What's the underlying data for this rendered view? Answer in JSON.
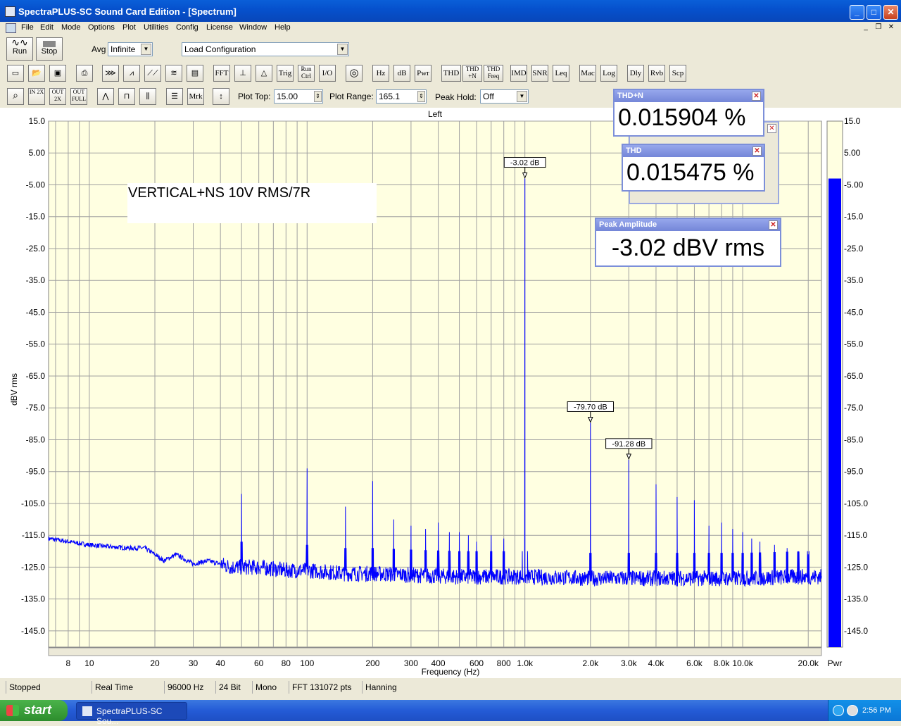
{
  "window": {
    "title": "SpectraPLUS-SC Sound Card Edition - [Spectrum]",
    "minimize": "_",
    "maximize": "□",
    "close": "✕"
  },
  "menu": [
    "File",
    "Edit",
    "Mode",
    "Options",
    "Plot",
    "Utilities",
    "Config",
    "License",
    "Window",
    "Help"
  ],
  "toolbar1": {
    "run": "Run",
    "stop": "Stop",
    "avg_label": "Avg",
    "avg_value": "Infinite",
    "load_config": "Load Configuration"
  },
  "toolbar2": [
    "FFT",
    "Trig",
    "Run Ctrl",
    "I/O",
    "Hz",
    "dB",
    "Pwr",
    "THD",
    "THD +N",
    "THD Freq",
    "IMD",
    "SNR",
    "Leq",
    "Mac",
    "Log",
    "Dly",
    "Rvb",
    "Scp"
  ],
  "toolbar3": {
    "mrk": "Mrk",
    "zoom_in": "IN 2X",
    "zoom_out": "OUT 2X",
    "zoom_full": "OUT FULL",
    "plot_top_label": "Plot Top:",
    "plot_top_value": "15.00",
    "plot_range_label": "Plot Range:",
    "plot_range_value": "165.1",
    "peak_hold_label": "Peak Hold:",
    "peak_hold_value": "Off"
  },
  "chart_data": {
    "type": "line",
    "title": "Left",
    "xlabel": "Frequency (Hz)",
    "ylabel": "dBV rms",
    "xscale": "log",
    "xlim": [
      6.5,
      23000
    ],
    "ylim": [
      -150.1,
      15
    ],
    "yticks": [
      15,
      5,
      -5,
      -15,
      -25,
      -35,
      -45,
      -55,
      -65,
      -75,
      -85,
      -95,
      -105,
      -115,
      -125,
      -135,
      -145
    ],
    "ytick_labels": [
      "15.0",
      "5.00",
      "-5.00",
      "-15.0",
      "-25.0",
      "-35.0",
      "-45.0",
      "-55.0",
      "-65.0",
      "-75.0",
      "-85.0",
      "-95.0",
      "-105.0",
      "-115.0",
      "-125.0",
      "-135.0",
      "-145.0"
    ],
    "xticks": [
      8,
      10,
      20,
      30,
      40,
      60,
      80,
      100,
      200,
      300,
      400,
      600,
      800,
      1000,
      2000,
      3000,
      4000,
      6000,
      8000,
      10000,
      20000
    ],
    "xtick_labels": [
      "8",
      "10",
      "20",
      "30",
      "40",
      "60",
      "80",
      "100",
      "200",
      "300",
      "400",
      "600",
      "800",
      "1.0k",
      "2.0k",
      "3.0k",
      "4.0k",
      "6.0k",
      "8.0k",
      "10.0k",
      "20.0k"
    ],
    "grid": true,
    "annotation": "VERTICAL+NS 10V RMS/7R",
    "noise_floor": [
      [
        6.5,
        -116
      ],
      [
        8,
        -117
      ],
      [
        10,
        -118
      ],
      [
        12,
        -118.5
      ],
      [
        15,
        -119
      ],
      [
        18,
        -119
      ],
      [
        20,
        -121
      ],
      [
        22,
        -123
      ],
      [
        25,
        -121
      ],
      [
        30,
        -124
      ],
      [
        35,
        -123
      ],
      [
        40,
        -124
      ],
      [
        45,
        -125
      ],
      [
        50,
        -125
      ],
      [
        60,
        -125
      ],
      [
        80,
        -126
      ],
      [
        100,
        -126
      ],
      [
        150,
        -127
      ],
      [
        200,
        -127
      ],
      [
        300,
        -127.5
      ],
      [
        500,
        -128
      ],
      [
        800,
        -128
      ],
      [
        1000,
        -128
      ],
      [
        2000,
        -128.5
      ],
      [
        5000,
        -128.5
      ],
      [
        10000,
        -128.5
      ],
      [
        20000,
        -128
      ],
      [
        23000,
        -128
      ]
    ],
    "peaks": [
      {
        "f": 50,
        "db": -102
      },
      {
        "f": 100,
        "db": -94
      },
      {
        "f": 150,
        "db": -106
      },
      {
        "f": 200,
        "db": -98
      },
      {
        "f": 250,
        "db": -110
      },
      {
        "f": 300,
        "db": -112
      },
      {
        "f": 350,
        "db": -113
      },
      {
        "f": 400,
        "db": -111
      },
      {
        "f": 450,
        "db": -114
      },
      {
        "f": 500,
        "db": -114
      },
      {
        "f": 550,
        "db": -115
      },
      {
        "f": 600,
        "db": -117
      },
      {
        "f": 700,
        "db": -115
      },
      {
        "f": 800,
        "db": -116
      },
      {
        "f": 1000,
        "db": -3.02,
        "label": "-3.02 dB"
      },
      {
        "f": 2000,
        "db": -79.7,
        "label": "-79.70 dB"
      },
      {
        "f": 3000,
        "db": -91.28,
        "label": "-91.28 dB"
      },
      {
        "f": 4000,
        "db": -99
      },
      {
        "f": 5000,
        "db": -103
      },
      {
        "f": 6000,
        "db": -104
      },
      {
        "f": 7000,
        "db": -112
      },
      {
        "f": 8000,
        "db": -111
      },
      {
        "f": 9000,
        "db": -113
      },
      {
        "f": 10000,
        "db": -114
      },
      {
        "f": 11000,
        "db": -116
      },
      {
        "f": 12000,
        "db": -117
      },
      {
        "f": 14000,
        "db": -118
      },
      {
        "f": 16000,
        "db": -119
      },
      {
        "f": 18000,
        "db": -120
      },
      {
        "f": 20000,
        "db": -121
      }
    ],
    "pwr_meter": {
      "label": "Pwr",
      "level_db": -3.02
    }
  },
  "colors": {
    "plot_bg": "#ffffe1",
    "trace": "#0000ff",
    "meter": "#0000ff"
  },
  "meters": [
    {
      "title": "THD+N",
      "value": "0.015904 %"
    },
    {
      "title": "THD",
      "value": "0.015475 %"
    },
    {
      "title": "Peak Amplitude",
      "value": "-3.02 dBV rms"
    }
  ],
  "status": [
    "Stopped",
    "Real Time",
    "96000 Hz",
    "24 Bit",
    "Mono",
    "FFT 131072 pts",
    "Hanning"
  ],
  "taskbar": {
    "start": "start",
    "item": "SpectraPLUS-SC Sou...",
    "clock": "2:56 PM"
  }
}
